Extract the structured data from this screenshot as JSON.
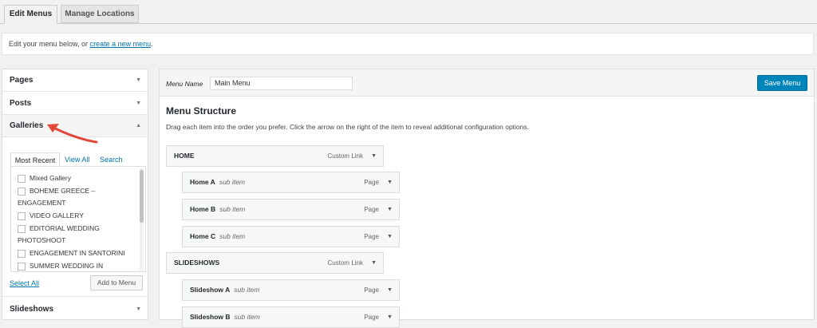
{
  "tabs": {
    "edit": "Edit Menus",
    "manage": "Manage Locations"
  },
  "notice": {
    "prefix": "Edit your menu below, or ",
    "link": "create a new menu",
    "suffix": "."
  },
  "accordion": {
    "pages": "Pages",
    "posts": "Posts",
    "galleries": "Galleries",
    "slideshows": "Slideshows",
    "subtabs": {
      "recent": "Most Recent",
      "all": "View All",
      "search": "Search"
    },
    "gallery_items": [
      "Mixed Gallery",
      "BOHEME GREECE –",
      "ENGAGEMENT",
      "VIDEO GALLERY",
      "EDITORIAL WEDDING",
      "PHOTOSHOOT",
      "ENGAGEMENT IN SANTORINI",
      "SUMMER WEDDING IN"
    ],
    "select_all": "Select All",
    "add_to_menu": "Add to Menu"
  },
  "menu": {
    "name_label": "Menu Name",
    "name_value": "Main Menu",
    "save_label": "Save Menu",
    "structure_title": "Menu Structure",
    "structure_desc": "Drag each item into the order you prefer. Click the arrow on the right of the item to reveal additional configuration options.",
    "sub_item_label": "sub item",
    "items": [
      {
        "title": "HOME",
        "type": "Custom Link"
      },
      {
        "title": "Home A",
        "type": "Page"
      },
      {
        "title": "Home B",
        "type": "Page"
      },
      {
        "title": "Home C",
        "type": "Page"
      },
      {
        "title": "SLIDESHOWS",
        "type": "Custom Link"
      },
      {
        "title": "Slideshow A",
        "type": "Page"
      },
      {
        "title": "Slideshow B",
        "type": "Page"
      }
    ]
  },
  "colors": {
    "accent": "#0085ba",
    "link": "#0073aa",
    "annotation": "#e04a3a"
  },
  "icons": [
    "chevron-down-icon",
    "chevron-up-icon",
    "annotation-arrow-icon"
  ]
}
